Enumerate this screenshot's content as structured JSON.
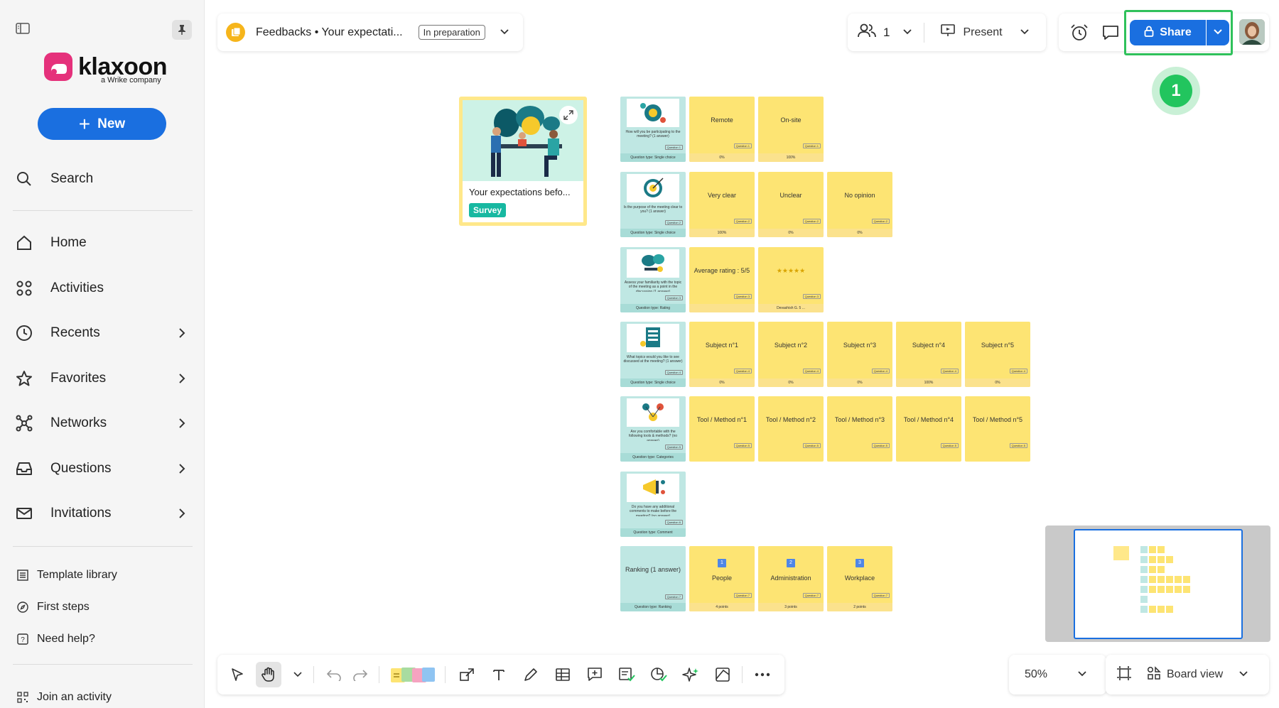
{
  "brand": {
    "name": "klaxoon",
    "subtitle": "a Wrike company",
    "accent": "#e5317b",
    "primary": "#1a6fe0"
  },
  "sidebar": {
    "new_label": "New",
    "search_label": "Search",
    "items": [
      {
        "label": "Home",
        "icon": "home-icon"
      },
      {
        "label": "Activities",
        "icon": "activities-icon"
      },
      {
        "label": "Recents",
        "icon": "clock-icon"
      },
      {
        "label": "Favorites",
        "icon": "star-icon"
      },
      {
        "label": "Networks",
        "icon": "network-icon"
      },
      {
        "label": "Questions",
        "icon": "inbox-icon"
      },
      {
        "label": "Invitations",
        "icon": "mail-icon"
      }
    ],
    "footer": [
      {
        "label": "Template library",
        "icon": "template-icon"
      },
      {
        "label": "First steps",
        "icon": "compass-icon"
      },
      {
        "label": "Need help?",
        "icon": "help-icon"
      },
      {
        "label": "Join an activity",
        "icon": "qr-icon"
      }
    ]
  },
  "header": {
    "board_title": "Feedbacks • Your expectati...",
    "status": "In preparation",
    "participants": "1",
    "present_label": "Present",
    "share_label": "Share",
    "step_number": "1"
  },
  "board": {
    "survey": {
      "title": "Your expectations befo...",
      "tag": "Survey"
    },
    "rows": [
      {
        "question": "How will you be participating to the meeting? (1 answer)",
        "tag": "Question 1",
        "type_label": "Question type",
        "type": "Single choice",
        "answers": [
          {
            "text": "Remote",
            "tag": "Question 1",
            "foot": "0%"
          },
          {
            "text": "On-site",
            "tag": "Question 1",
            "foot": "100%"
          }
        ]
      },
      {
        "question": "Is the purpose of the meeting clear to you? (1 answer)",
        "tag": "Question 2",
        "type_label": "Question type",
        "type": "Single choice",
        "answers": [
          {
            "text": "Very clear",
            "tag": "Question 2",
            "foot": "100%"
          },
          {
            "text": "Unclear",
            "tag": "Question 2",
            "foot": "0%"
          },
          {
            "text": "No opinion",
            "tag": "Question 2",
            "foot": "0%"
          }
        ]
      },
      {
        "question": "Assess your familiarity with the topic of the meeting as a point in the discussion (1 answer)",
        "tag": "Question 3",
        "type_label": "Question type",
        "type": "Rating",
        "answers": [
          {
            "text": "Average rating : 5/5",
            "tag": "Question 3",
            "foot": ""
          },
          {
            "text": "★★★★★",
            "tag": "Question 3",
            "foot": "Devashish G.   5 ..."
          }
        ]
      },
      {
        "question": "What topics would you like to see discussed at the meeting? (1 answer)",
        "tag": "Question 4",
        "type_label": "Question type",
        "type": "Single choice",
        "answers": [
          {
            "text": "Subject n°1",
            "tag": "Question 4",
            "foot": "0%"
          },
          {
            "text": "Subject n°2",
            "tag": "Question 4",
            "foot": "0%"
          },
          {
            "text": "Subject n°3",
            "tag": "Question 4",
            "foot": "0%"
          },
          {
            "text": "Subject n°4",
            "tag": "Question 4",
            "foot": "100%"
          },
          {
            "text": "Subject n°5",
            "tag": "Question 4",
            "foot": "0%"
          }
        ]
      },
      {
        "question": "Are you comfortable with the following tools & methods? (no answer)",
        "tag": "Question 5",
        "type_label": "Question type",
        "type": "Categories",
        "answers": [
          {
            "text": "Tool / Method n°1",
            "tag": "Question 5",
            "foot": ""
          },
          {
            "text": "Tool / Method n°2",
            "tag": "Question 5",
            "foot": ""
          },
          {
            "text": "Tool / Method n°3",
            "tag": "Question 5",
            "foot": ""
          },
          {
            "text": "Tool / Method n°4",
            "tag": "Question 5",
            "foot": ""
          },
          {
            "text": "Tool / Method n°5",
            "tag": "Question 5",
            "foot": ""
          }
        ]
      },
      {
        "question": "Do you have any additional comments to make before the meeting? (no answer)",
        "tag": "Question 6",
        "type_label": "Question type",
        "type": "Comment",
        "answers": []
      }
    ],
    "ranking": {
      "label": "Ranking (1 answer)",
      "tag": "Question 7",
      "type_label": "Question type",
      "type": "Ranking",
      "answers": [
        {
          "num": "1",
          "text": "People",
          "tag": "Question 7",
          "foot": "4 points"
        },
        {
          "num": "2",
          "text": "Administration",
          "tag": "Question 7",
          "foot": "3 points"
        },
        {
          "num": "3",
          "text": "Workplace",
          "tag": "Question 7",
          "foot": "2 points"
        }
      ]
    }
  },
  "bottom": {
    "zoom": "50%",
    "view_label": "Board view"
  }
}
